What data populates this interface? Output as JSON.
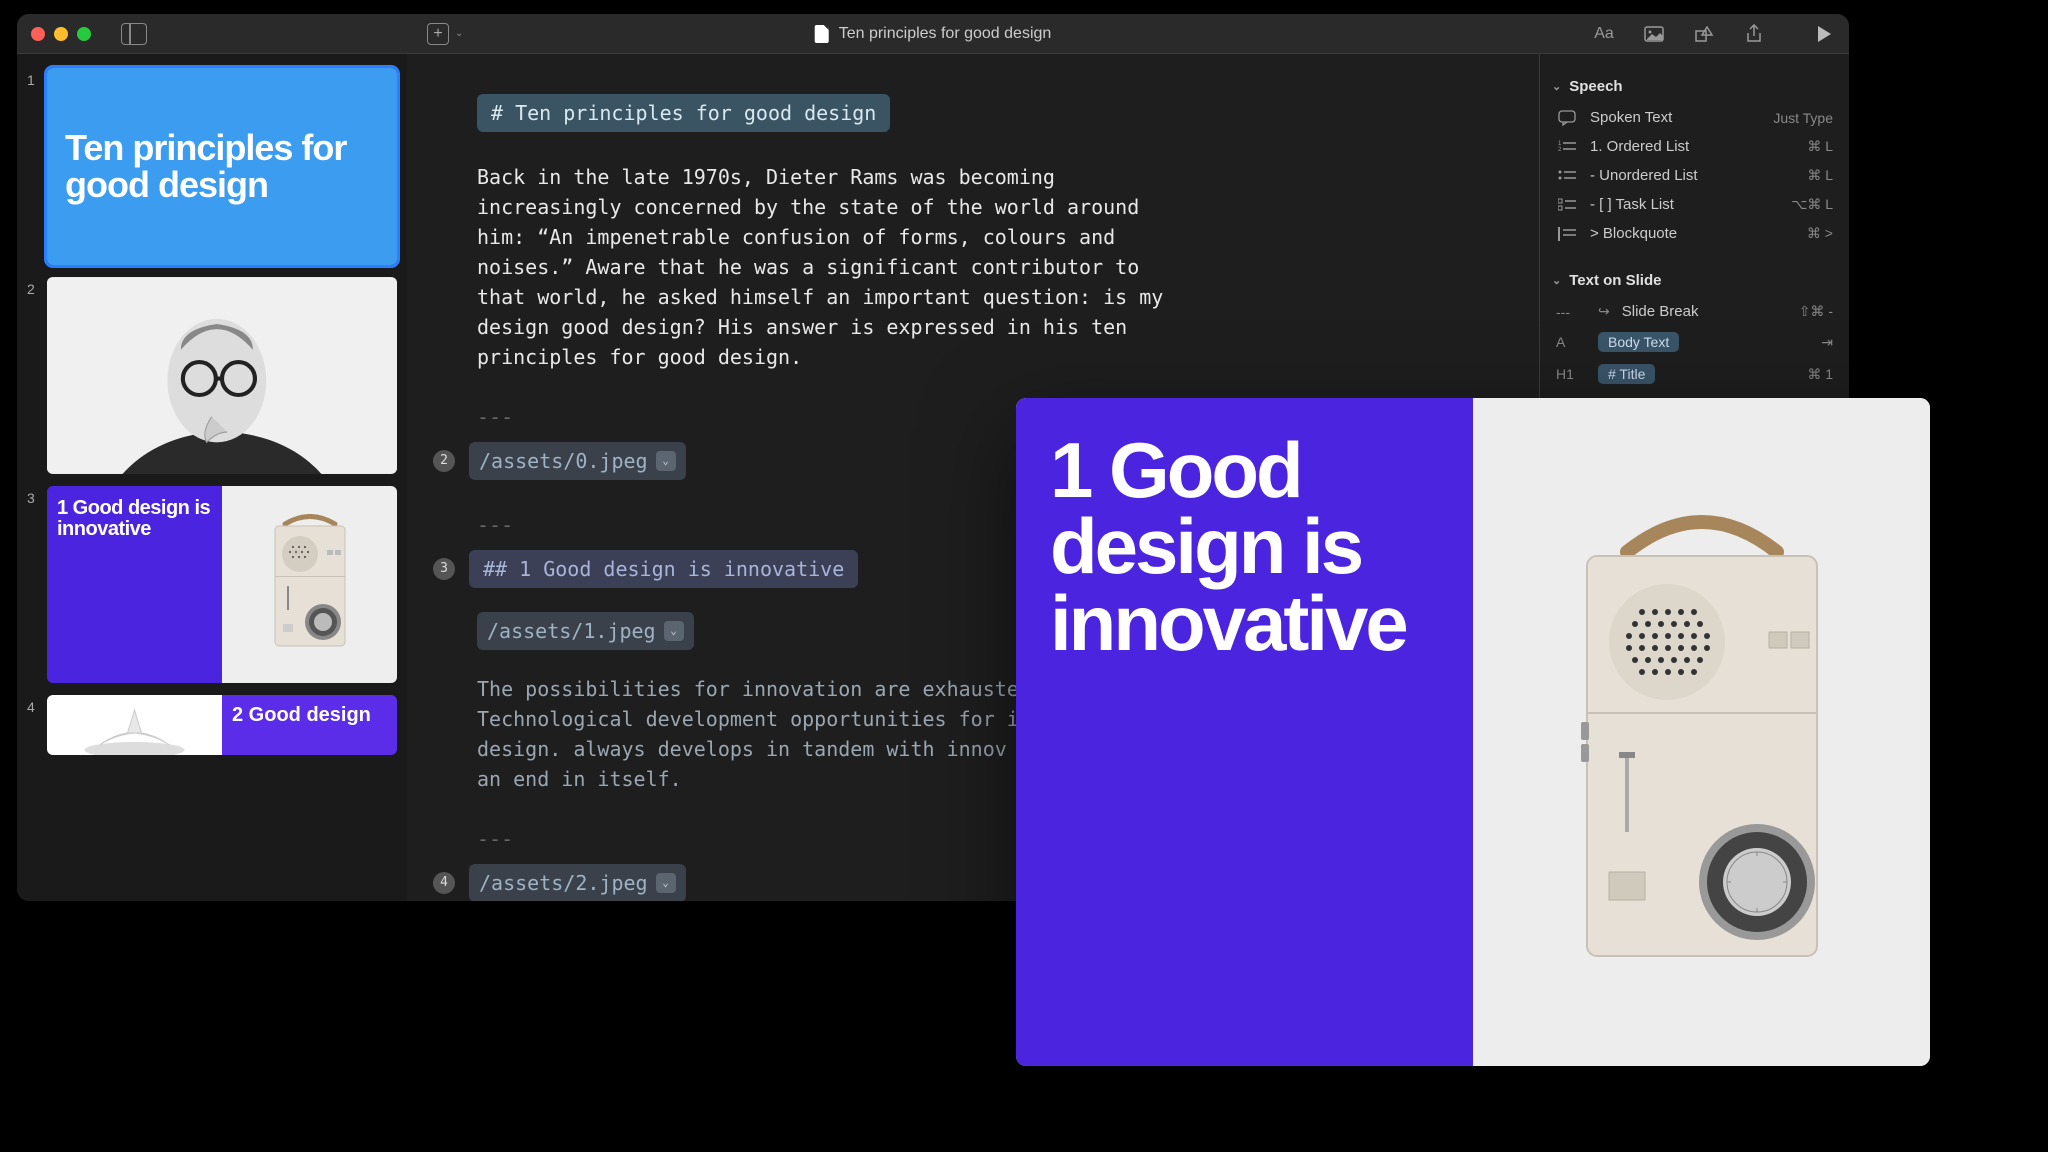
{
  "document": {
    "title": "Ten principles for good design"
  },
  "slides": {
    "1": {
      "title": "Ten principles for good design"
    },
    "3": {
      "title": "1 Good design is innovative"
    },
    "4": {
      "title": "2 Good design"
    }
  },
  "editor": {
    "heading": "# Ten principles for good design",
    "para1": "Back in the late 1970s, Dieter Rams was becoming increasingly concerned by the state of the world around him: “An impenetrable confusion of forms, colours and noises.” Aware that he was a significant contributor to that world, he asked himself an important question: is my design good design? His answer is expressed in his ten principles for good design.",
    "hr": "---",
    "badge2": "2",
    "asset0": "/assets/0.jpeg",
    "badge3": "3",
    "subheading": "## 1 Good design is innovative",
    "asset1": "/assets/1.jpeg",
    "para2": "The possibilities for innovation are exhausted. Technological development opportunities for innovative design. always develops in tandem with innov can never be an end in itself.",
    "badge4": "4",
    "asset2": "/assets/2.jpeg"
  },
  "inspector": {
    "speech": {
      "header": "Speech",
      "spoken_text": {
        "label": "Spoken Text",
        "shortcut": "Just Type"
      },
      "ordered": {
        "label": "1. Ordered List",
        "shortcut": "⌘ L"
      },
      "unordered": {
        "label": "- Unordered List",
        "shortcut": "⌘ L"
      },
      "task": {
        "label": "- [ ] Task List",
        "shortcut": "⌥⌘ L"
      },
      "blockquote": {
        "label": "> Blockquote",
        "shortcut": "⌘ >"
      }
    },
    "text_on_slide": {
      "header": "Text on Slide",
      "slide_break": {
        "prefix": "---",
        "label": "Slide Break",
        "shortcut": "⇧⌘ -"
      },
      "body_text": {
        "prefix": "A",
        "pill": "Body Text",
        "arrow": "⇥"
      },
      "title": {
        "prefix": "H1",
        "pill": "# Title",
        "shortcut": "⌘ 1"
      }
    }
  },
  "preview": {
    "title": "1 Good design is innovative"
  }
}
